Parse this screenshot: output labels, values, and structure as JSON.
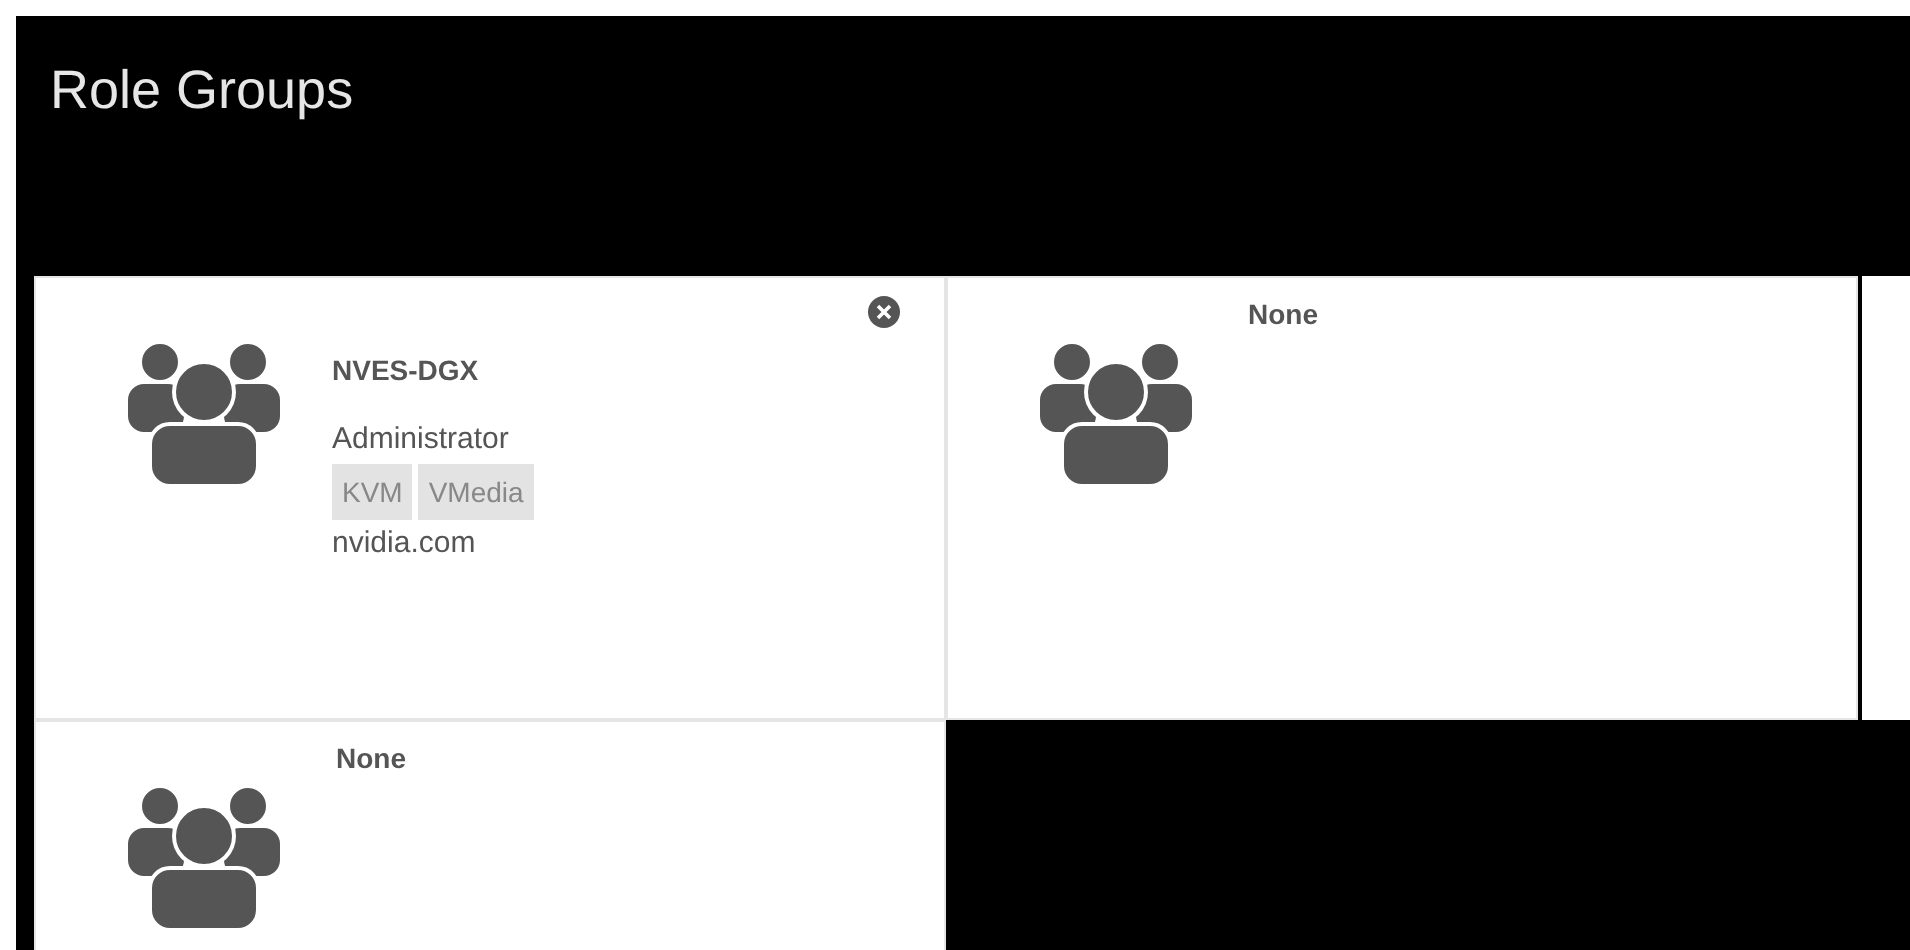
{
  "title": "Role Groups",
  "cards": [
    {
      "name": "NVES-DGX",
      "role": "Administrator",
      "privileges": [
        "KVM",
        "VMedia"
      ],
      "domain": "nvidia.com",
      "removable": true
    },
    {
      "name": "None",
      "removable": false
    },
    {
      "name": "None",
      "removable": false
    }
  ]
}
